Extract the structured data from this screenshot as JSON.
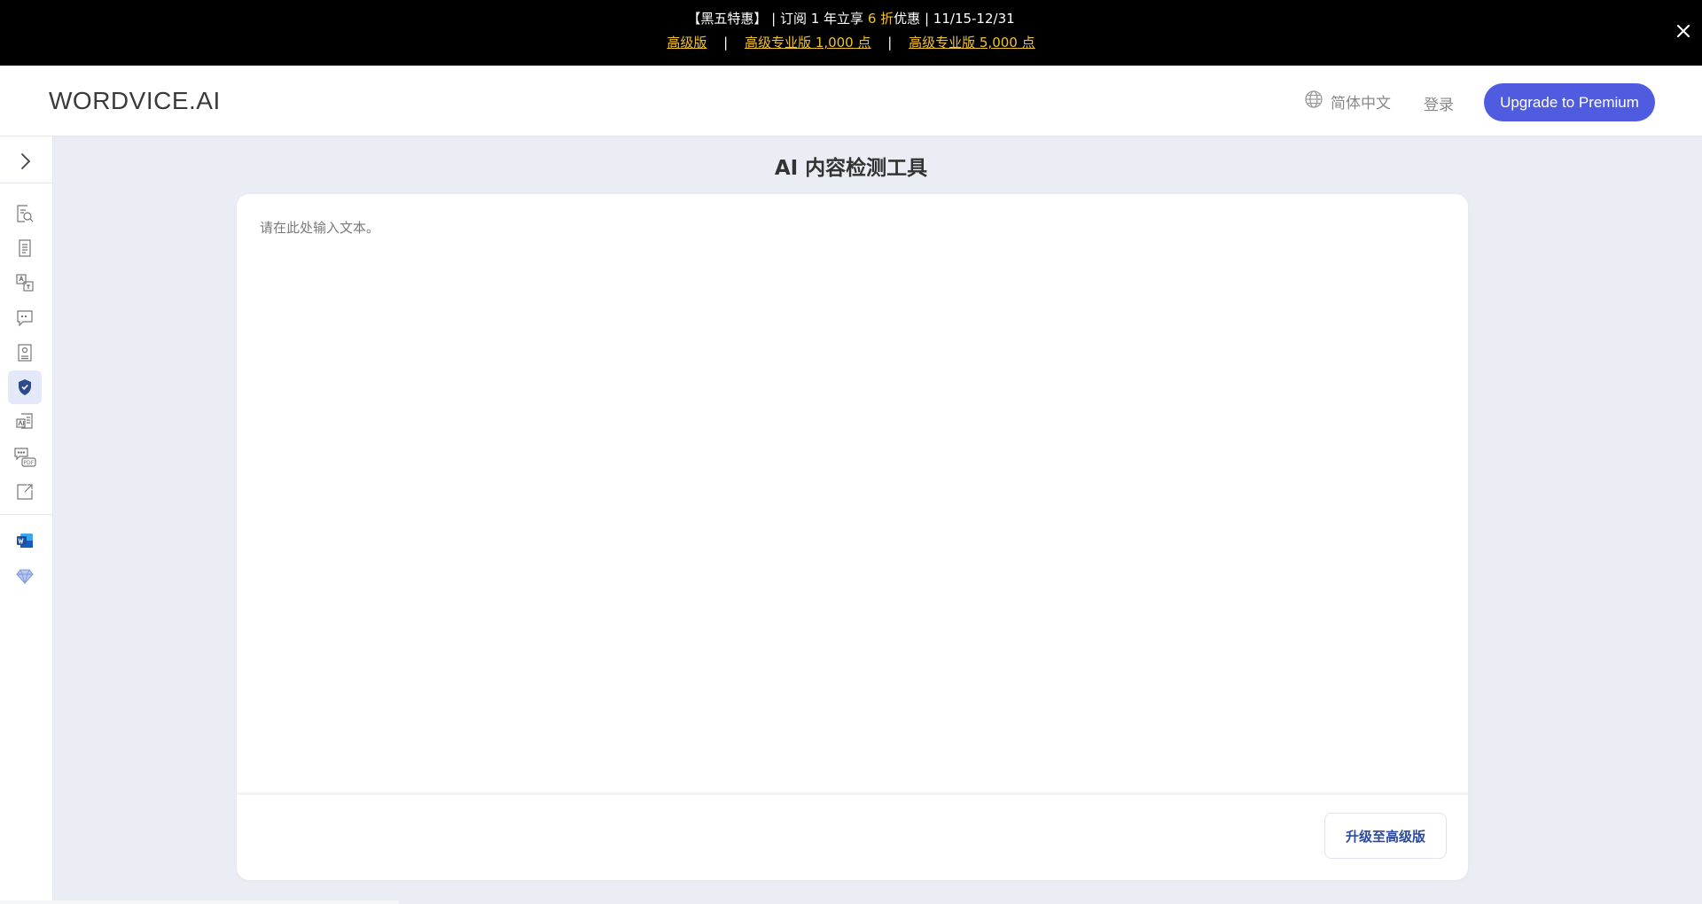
{
  "promo": {
    "line1_a": "【黑五特惠】",
    "line1_sep1": "|",
    "line1_b": "订阅 1 年立享",
    "line1_discount": "6 折",
    "line1_c": "优惠",
    "line1_sep2": "|",
    "line1_date": "11/15-12/31",
    "link_premium": "高级版",
    "link_pro_1000": "高级专业版 1,000 点",
    "link_pro_5000": "高级专业版 5,000 点",
    "link_sep": "|",
    "close_icon": "close-icon",
    "highlight_color": "#f0c22b"
  },
  "header": {
    "logo": "WORDVICE.AI",
    "language": "简体中文",
    "language_icon": "globe-icon",
    "login": "登录",
    "upgrade_button": "Upgrade to Premium",
    "accent_color": "#4f5ce0"
  },
  "sidebar": {
    "toggle_icon": "chevron-right-icon",
    "items": [
      {
        "icon": "proofread-search-icon"
      },
      {
        "icon": "document-icon"
      },
      {
        "icon": "translate-icon"
      },
      {
        "icon": "quote-chat-icon"
      },
      {
        "icon": "profile-document-icon"
      },
      {
        "icon": "ai-detector-shield-icon",
        "active": true
      },
      {
        "icon": "ai-document-icon"
      },
      {
        "icon": "pdf-chat-icon"
      },
      {
        "icon": "external-link-icon"
      }
    ],
    "extras": [
      {
        "icon": "microsoft-word-icon"
      },
      {
        "icon": "diamond-icon"
      }
    ]
  },
  "main": {
    "title": "AI 内容检测工具",
    "editor_placeholder": "请在此处输入文本。",
    "editor_value": "",
    "upgrade_button": "升级至高级版"
  }
}
